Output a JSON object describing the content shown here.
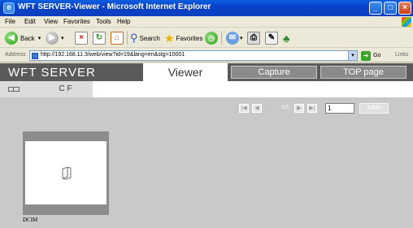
{
  "window": {
    "title": "WFT SERVER-Viewer - Microsoft Internet Explorer",
    "ie_glyph": "e",
    "controls": [
      "minimize",
      "maximize",
      "close"
    ]
  },
  "menu": {
    "items": [
      "File",
      "Edit",
      "View",
      "Favorites",
      "Tools",
      "Help"
    ]
  },
  "toolbar": {
    "back_label": "Back",
    "search_label": "Search",
    "favorites_label": "Favorites"
  },
  "address": {
    "label": "Address",
    "url": "http://192.168.11.3/web/view?id=19&lang=en&stg=10001",
    "go_label": "Go",
    "links_label": "Links"
  },
  "page": {
    "brand": "WFT SERVER",
    "tabs": {
      "viewer": "Viewer",
      "capture": "Capture",
      "top_page": "TOP page"
    },
    "drives": {
      "cf_label": "CF"
    },
    "pager": {
      "count": "1/1",
      "page_value": "1",
      "jump_label": "JUMP"
    },
    "folders": [
      {
        "name": "DCIM"
      }
    ]
  },
  "colors": {
    "titlebar": "#0842c8",
    "header": "#5a5a5a",
    "content_bg": "#c9c9c9",
    "nav_button": "#8a8a8a"
  }
}
